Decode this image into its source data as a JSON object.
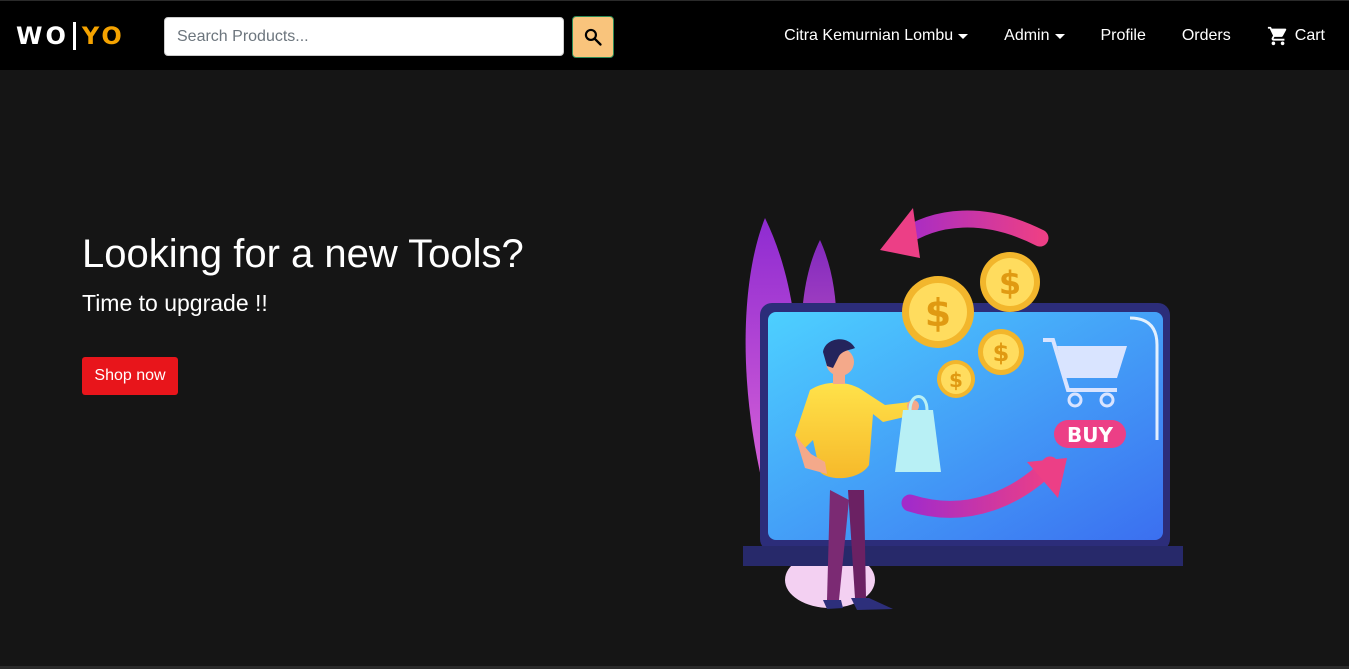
{
  "brand": {
    "logo_left": "WO",
    "logo_right": "YO",
    "accent_color": "#f5a300"
  },
  "search": {
    "placeholder": "Search Products...",
    "value": "",
    "button_icon": "search-icon",
    "button_color": "#f9c47c"
  },
  "nav": {
    "user_label": "Citra Kemurnian Lombu",
    "admin_label": "Admin",
    "profile_label": "Profile",
    "orders_label": "Orders",
    "cart_label": "Cart",
    "cart_icon": "cart-icon"
  },
  "hero": {
    "title": "Looking for a new Tools?",
    "subtitle": "Time to upgrade !!",
    "cta_label": "Shop now",
    "cta_color": "#e8151b",
    "illustration": {
      "buy_label": "BUY",
      "coin_symbol": "$"
    }
  }
}
